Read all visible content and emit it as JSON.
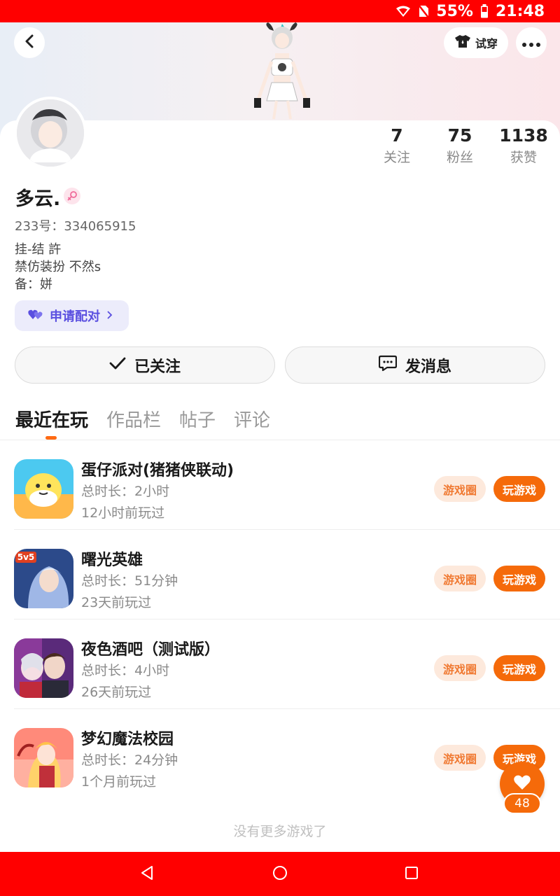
{
  "status_bar": {
    "battery": "55%",
    "time": "21:48"
  },
  "header": {
    "try_on_label": "试穿"
  },
  "stats": [
    {
      "value": "7",
      "label": "关注"
    },
    {
      "value": "75",
      "label": "粉丝"
    },
    {
      "value": "1138",
      "label": "获赞"
    }
  ],
  "profile": {
    "username": "多云.",
    "uid": "233号：334065915",
    "bio": [
      "挂-结 許",
      "禁仿装扮  不然s",
      "备：姘"
    ],
    "pair_label": "申请配对"
  },
  "actions": {
    "follow_label": "已关注",
    "message_label": "发消息"
  },
  "tabs": [
    {
      "label": "最近在玩",
      "active": true
    },
    {
      "label": "作品栏",
      "active": false
    },
    {
      "label": "帖子",
      "active": false
    },
    {
      "label": "评论",
      "active": false
    }
  ],
  "games": [
    {
      "name": "蛋仔派对(猪猪侠联动)",
      "duration": "总时长：2小时",
      "last_played": "12小时前玩过",
      "circle_label": "游戏圈",
      "play_label": "玩游戏",
      "icon": "eggy-party-icon",
      "icon_colors": [
        "#ffd24a",
        "#4cc9f0"
      ]
    },
    {
      "name": "曙光英雄",
      "duration": "总时长：51分钟",
      "last_played": "23天前玩过",
      "circle_label": "游戏圈",
      "play_label": "玩游戏",
      "icon": "dawn-heroes-icon",
      "icon_colors": [
        "#2c4a8a",
        "#9fb7e6"
      ]
    },
    {
      "name": "夜色酒吧（测试版）",
      "duration": "总时长：4小时",
      "last_played": "26天前玩过",
      "circle_label": "游戏圈",
      "play_label": "玩游戏",
      "icon": "night-bar-icon",
      "icon_colors": [
        "#5a2a7a",
        "#e7a0c0"
      ]
    },
    {
      "name": "梦幻魔法校园",
      "duration": "总时长：24分钟",
      "last_played": "1个月前玩过",
      "circle_label": "游戏圈",
      "play_label": "玩游戏",
      "icon": "magic-school-icon",
      "icon_colors": [
        "#ff8a7a",
        "#ffd0a0"
      ]
    }
  ],
  "footer_note": "没有更多游戏了",
  "like": {
    "count": "48"
  },
  "colors": {
    "accent": "#f56a0a",
    "status_bar": "#ff0000",
    "pair_text": "#5a4fe0"
  }
}
